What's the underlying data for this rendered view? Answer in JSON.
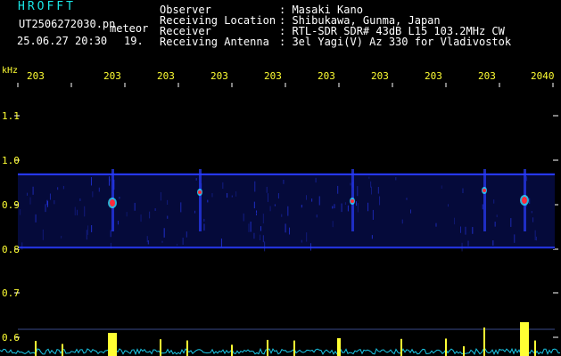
{
  "header": {
    "brand": "HROFFT",
    "file_name": "UT2506272030.pn",
    "tag": "meteor",
    "datetime": "25.06.27 20:30",
    "count": "19.",
    "rows": [
      {
        "label": "Observer",
        "value": ": Masaki Kano"
      },
      {
        "label": "Receiving Location",
        "value": ": Shibukawa, Gunma, Japan"
      },
      {
        "label": "Receiver",
        "value": ": RTL-SDR SDR# 43dB L15 103.2MHz CW"
      },
      {
        "label": "Receiving Antenna",
        "value": ": 3el Yagi(V) Az 330 for Vladivostok"
      }
    ]
  },
  "axes": {
    "unit": "kHz",
    "x_ticks": [
      "203",
      "203",
      "203",
      "203",
      "203",
      "203",
      "203",
      "203",
      "203",
      "2040"
    ],
    "y_ticks": [
      "1.1",
      "1.0",
      "0.9",
      "0.8",
      "0.7",
      "0.6"
    ]
  },
  "colors": {
    "cyan_text": "#19e6e6",
    "tick_yellow": "#ffff33",
    "band_blue": "#2a3cff",
    "echo_red": "#ff2a3a"
  }
}
